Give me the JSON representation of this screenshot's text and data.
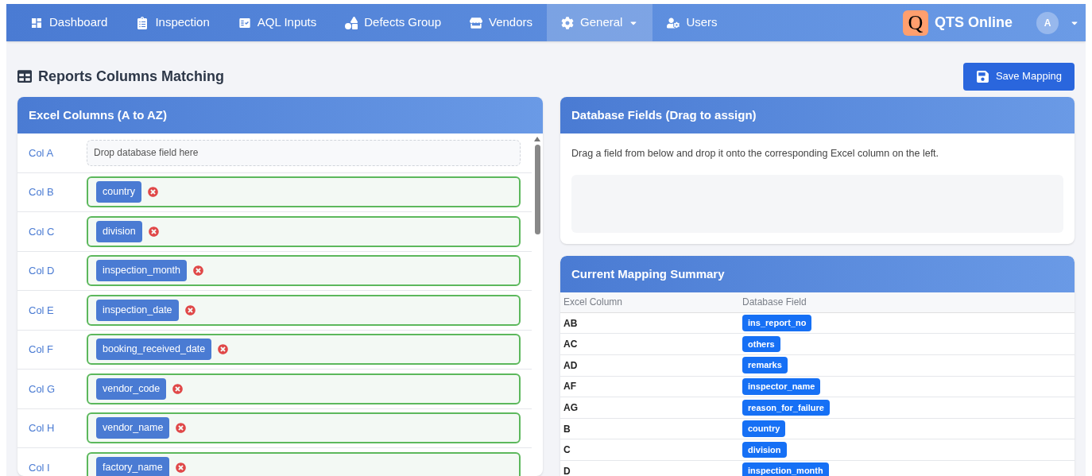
{
  "nav": {
    "items": [
      {
        "label": "Dashboard",
        "selected": false,
        "dropdown": false
      },
      {
        "label": "Inspection",
        "selected": false,
        "dropdown": false
      },
      {
        "label": "AQL Inputs",
        "selected": false,
        "dropdown": false
      },
      {
        "label": "Defects Group",
        "selected": false,
        "dropdown": false
      },
      {
        "label": "Vendors",
        "selected": false,
        "dropdown": false
      },
      {
        "label": "General",
        "selected": true,
        "dropdown": true
      },
      {
        "label": "Users",
        "selected": false,
        "dropdown": false
      }
    ],
    "brand": {
      "logo": "Q",
      "name": "QTS Online"
    },
    "user": {
      "initial": "A"
    }
  },
  "page_title": "Reports Columns Matching",
  "save_button": "Save Mapping",
  "excel_panel": {
    "title": "Excel Columns (A to AZ)",
    "rows": [
      {
        "column": "Col A",
        "kind": "empty",
        "placeholder": "Drop database field here"
      },
      {
        "column": "Col B",
        "kind": "assigned",
        "field": "country"
      },
      {
        "column": "Col C",
        "kind": "assigned",
        "field": "division"
      },
      {
        "column": "Col D",
        "kind": "assigned",
        "field": "inspection_month"
      },
      {
        "column": "Col E",
        "kind": "assigned",
        "field": "inspection_date"
      },
      {
        "column": "Col F",
        "kind": "assigned",
        "field": "booking_received_date"
      },
      {
        "column": "Col G",
        "kind": "assigned",
        "field": "vendor_code"
      },
      {
        "column": "Col H",
        "kind": "assigned",
        "field": "vendor_name"
      },
      {
        "column": "Col I",
        "kind": "assigned",
        "field": "factory_name"
      }
    ]
  },
  "db_panel": {
    "title": "Database Fields (Drag to assign)",
    "instruction": "Drag a field from below and drop it onto the corresponding Excel column on the left."
  },
  "summary": {
    "title": "Current Mapping Summary",
    "columns": [
      "Excel Column",
      "Database Field"
    ],
    "rows": [
      {
        "column": "AB",
        "field": "ins_report_no"
      },
      {
        "column": "AC",
        "field": "others"
      },
      {
        "column": "AD",
        "field": "remarks"
      },
      {
        "column": "AF",
        "field": "inspector_name"
      },
      {
        "column": "AG",
        "field": "reason_for_failure"
      },
      {
        "column": "B",
        "field": "country"
      },
      {
        "column": "C",
        "field": "division"
      },
      {
        "column": "D",
        "field": "inspection_month"
      }
    ]
  }
}
